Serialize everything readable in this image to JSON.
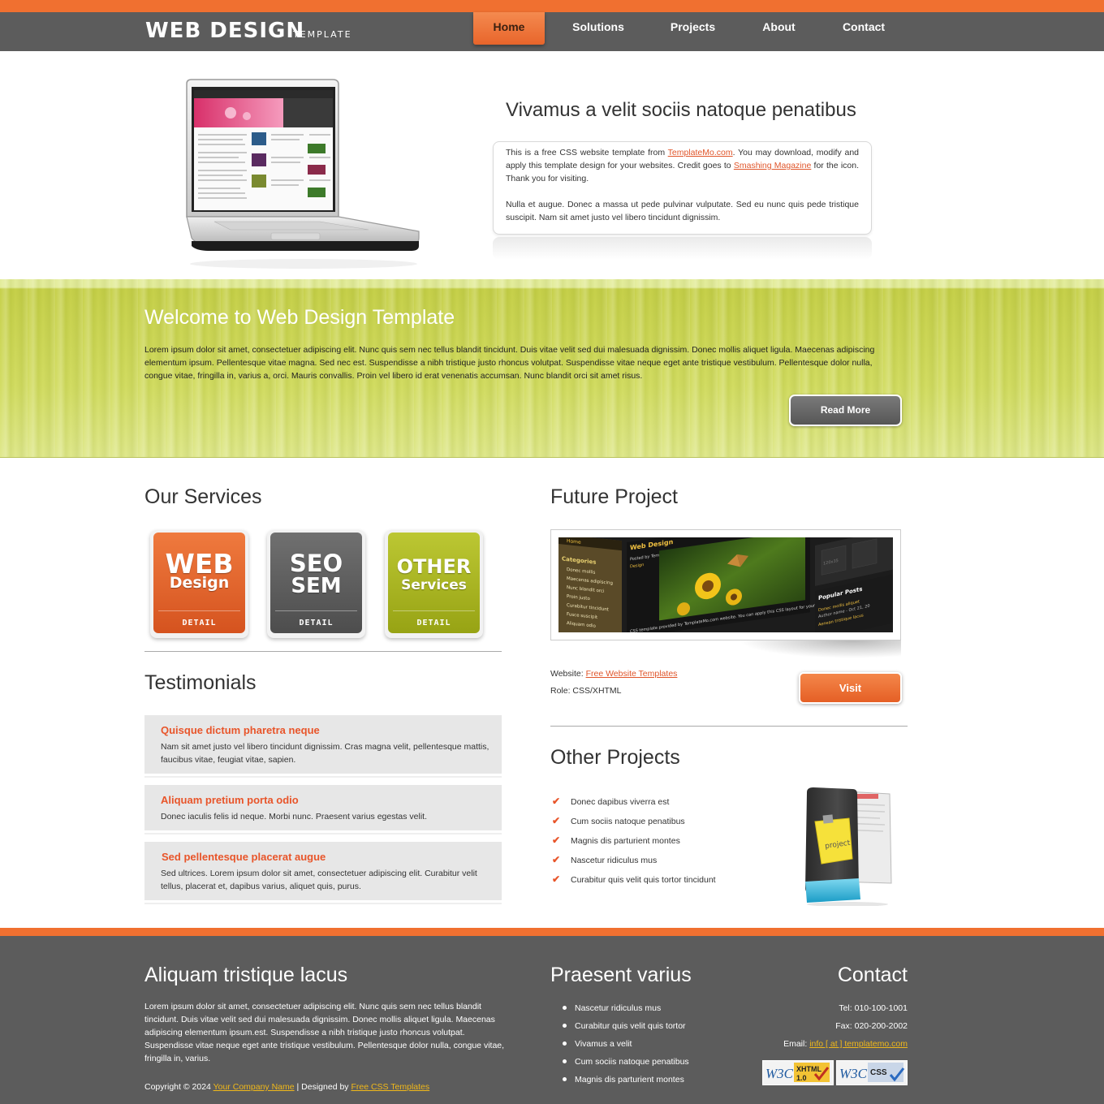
{
  "header": {
    "logo_main": "WEB DESIGN",
    "logo_sub": "TEMPLATE",
    "nav": [
      {
        "label": "Home",
        "active": true
      },
      {
        "label": "Solutions",
        "active": false
      },
      {
        "label": "Projects",
        "active": false
      },
      {
        "label": "About",
        "active": false
      },
      {
        "label": "Contact",
        "active": false
      }
    ]
  },
  "hero": {
    "title": "Vivamus a velit sociis natoque penatibus",
    "p1_before": "This is a free CSS website template from ",
    "p1_link1": "TemplateMo.com",
    "p1_middle": ". You may download, modify and apply this template design for your websites. Credit goes to ",
    "p1_link2": "Smashing Magazine",
    "p1_after": " for the icon. Thank you for visiting.",
    "p2": "Nulla et augue. Donec a massa ut pede pulvinar vulputate. Sed eu nunc quis pede tristique suscipit. Nam sit amet justo vel libero tincidunt dignissim."
  },
  "banner": {
    "title": "Welcome to Web Design Template",
    "text": "Lorem ipsum dolor sit amet, consectetuer adipiscing elit. Nunc quis sem nec tellus blandit tincidunt. Duis vitae velit sed dui malesuada dignissim. Donec mollis aliquet ligula. Maecenas adipiscing elementum ipsum. Pellentesque vitae magna. Sed nec est. Suspendisse a nibh tristique justo rhoncus volutpat. Suspendisse vitae neque eget ante tristique vestibulum. Pellentesque dolor nulla, congue vitae, fringilla in, varius a, orci. Mauris convallis. Proin vel libero id erat venenatis accumsan. Nunc blandit orci sit amet risus.",
    "button": "Read More"
  },
  "services": {
    "title": "Our Services",
    "items": [
      {
        "line1": "WEB",
        "line2": "Design",
        "detail": "DETAIL",
        "color": "#e2602a"
      },
      {
        "line1": "SEO",
        "line2": "SEM",
        "detail": "DETAIL",
        "color": "#5e5e5e"
      },
      {
        "line1": "OTHER",
        "line2": "Services",
        "detail": "DETAIL",
        "color": "#a8b41f"
      }
    ]
  },
  "testimonials": {
    "title": "Testimonials",
    "items": [
      {
        "title": "Quisque dictum pharetra neque",
        "text": "Nam sit amet justo vel libero tincidunt dignissim. Cras magna velit, pellentesque mattis, faucibus vitae, feugiat vitae, sapien."
      },
      {
        "title": "Aliquam pretium porta odio",
        "text": "Donec iaculis felis id neque. Morbi nunc. Praesent varius egestas velit."
      },
      {
        "title": "Sed pellentesque placerat augue",
        "text": "Sed ultrices. Lorem ipsum dolor sit amet, consectetuer adipiscing elit. Curabitur velit tellus, placerat et, dapibus varius, aliquet quis, purus."
      }
    ]
  },
  "future": {
    "title": "Future Project",
    "screenshot": {
      "nav": "Home",
      "logo": "Web Design",
      "sidebar_title": "Categories",
      "sidebar_items": [
        "Donec mollis",
        "Maecenas adipiscing",
        "Nunc blandit orci",
        "Proin justo",
        "Curabitur tincidunt",
        "Fusce suscipit",
        "Aliquam odio"
      ],
      "posted": "Posted by TemplateMo.com, Decem...",
      "caption": "Design",
      "body_text": "CSS template provided by TemplateMo.com website. You can apply this CSS layout for your personal",
      "side_box": "120x35",
      "popular_title": "Popular Posts",
      "popular_1": "Donec mollis aliquet",
      "popular_2": "Author name - Oct 21, 20",
      "popular_3": "Aenean tristique lacus"
    },
    "website_label": "Website: ",
    "website_link": "Free Website Templates",
    "role": "Role: CSS/XHTML",
    "button": "Visit"
  },
  "other_projects": {
    "title": "Other Projects",
    "items": [
      "Donec dapibus viverra est",
      "Cum sociis natoque penatibus",
      "Magnis dis parturient montes",
      "Nascetur ridiculus mus",
      "Curabitur quis velit quis tortor tincidunt"
    ],
    "folder_note": "project"
  },
  "footer": {
    "col1_title": "Aliquam tristique lacus",
    "col1_text": "Lorem ipsum dolor sit amet, consectetuer adipiscing elit. Nunc quis sem nec tellus blandit tincidunt. Duis vitae velit sed dui malesuada dignissim. Donec mollis aliquet ligula. Maecenas adipiscing elementum ipsum.est. Suspendisse a nibh tristique justo rhoncus volutpat. Suspendisse vitae neque eget ante tristique vestibulum. Pellentesque dolor nulla, congue vitae, fringilla in, varius.",
    "copyright_before": "Copyright © 2024 ",
    "company_link": "Your Company Name",
    "copyright_middle": " | Designed by ",
    "designer_link": "Free CSS Templates",
    "col2_title": "Praesent varius",
    "col2_items": [
      "Nascetur ridiculus mus",
      "Curabitur quis velit quis tortor",
      "Vivamus a velit",
      "Cum sociis natoque penatibus",
      "Magnis dis parturient montes"
    ],
    "col3_title": "Contact",
    "tel": "Tel: 010-100-1001",
    "fax": "Fax: 020-200-2002",
    "email_label": "Email: ",
    "email_link": "info [ at ] templatemo.com",
    "badge_xhtml": "XHTML",
    "badge_xhtml_ver": "1.0",
    "badge_css": "CSS",
    "badge_w3c": "W3C"
  },
  "colors": {
    "accent": "#f07030",
    "dark": "#5c5c5c",
    "link": "#e0552a",
    "footer_link": "#f0b81a",
    "banner": "#d2dc62"
  }
}
